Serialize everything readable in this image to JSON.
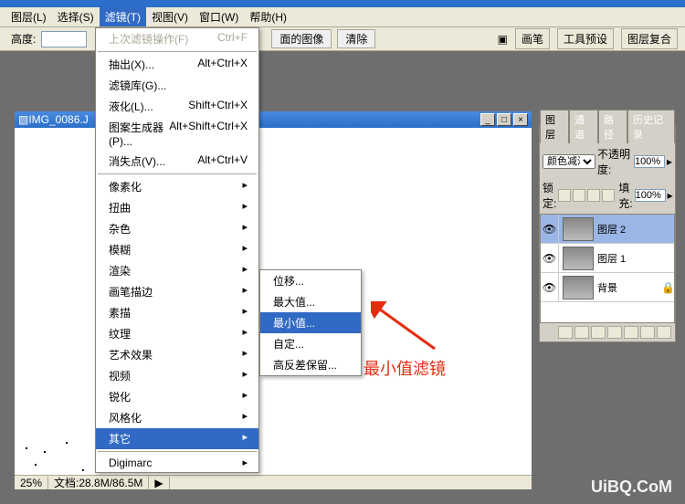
{
  "menubar": {
    "items": [
      "图层(L)",
      "选择(S)",
      "滤镜(T)",
      "视图(V)",
      "窗口(W)",
      "帮助(H)"
    ],
    "activeIndex": 2
  },
  "toolbar": {
    "height_label": "高度:",
    "height_value": "",
    "btn1_label": "面的图像",
    "btn2_label": "清除",
    "tabs": [
      "画笔",
      "工具预设",
      "图层复合"
    ]
  },
  "dropdown": {
    "last": {
      "label": "上次滤镜操作(F)",
      "shortcut": "Ctrl+F"
    },
    "group1": [
      {
        "label": "抽出(X)...",
        "shortcut": "Alt+Ctrl+X"
      },
      {
        "label": "滤镜库(G)...",
        "shortcut": ""
      },
      {
        "label": "液化(L)...",
        "shortcut": "Shift+Ctrl+X"
      },
      {
        "label": "图案生成器(P)...",
        "shortcut": "Alt+Shift+Ctrl+X"
      },
      {
        "label": "消失点(V)...",
        "shortcut": "Alt+Ctrl+V"
      }
    ],
    "group2": [
      "像素化",
      "扭曲",
      "杂色",
      "模糊",
      "渲染",
      "画笔描边",
      "素描",
      "纹理",
      "艺术效果",
      "视频",
      "锐化",
      "风格化",
      "其它"
    ],
    "digimarc": "Digimarc"
  },
  "submenu": {
    "items": [
      "位移...",
      "最大值...",
      "最小值...",
      "自定...",
      "高反差保留..."
    ],
    "activeIndex": 2
  },
  "annotation": "最小值滤镜",
  "document": {
    "title": "IMG_0086.J",
    "zoom": "25%",
    "docsize": "文档:28.8M/86.5M"
  },
  "layers_panel": {
    "tabs": [
      "图层",
      "通道",
      "路径",
      "历史记录"
    ],
    "blend": "颜色减淡",
    "opacity_label": "不透明度:",
    "opacity": "100%",
    "lock_label": "锁定:",
    "fill_label": "填充:",
    "fill": "100%",
    "layers": [
      {
        "name": "图层 2",
        "selected": true,
        "locked": false
      },
      {
        "name": "图层 1",
        "selected": false,
        "locked": false
      },
      {
        "name": "背景",
        "selected": false,
        "locked": true
      }
    ]
  },
  "watermark": "UiBQ.CoM"
}
